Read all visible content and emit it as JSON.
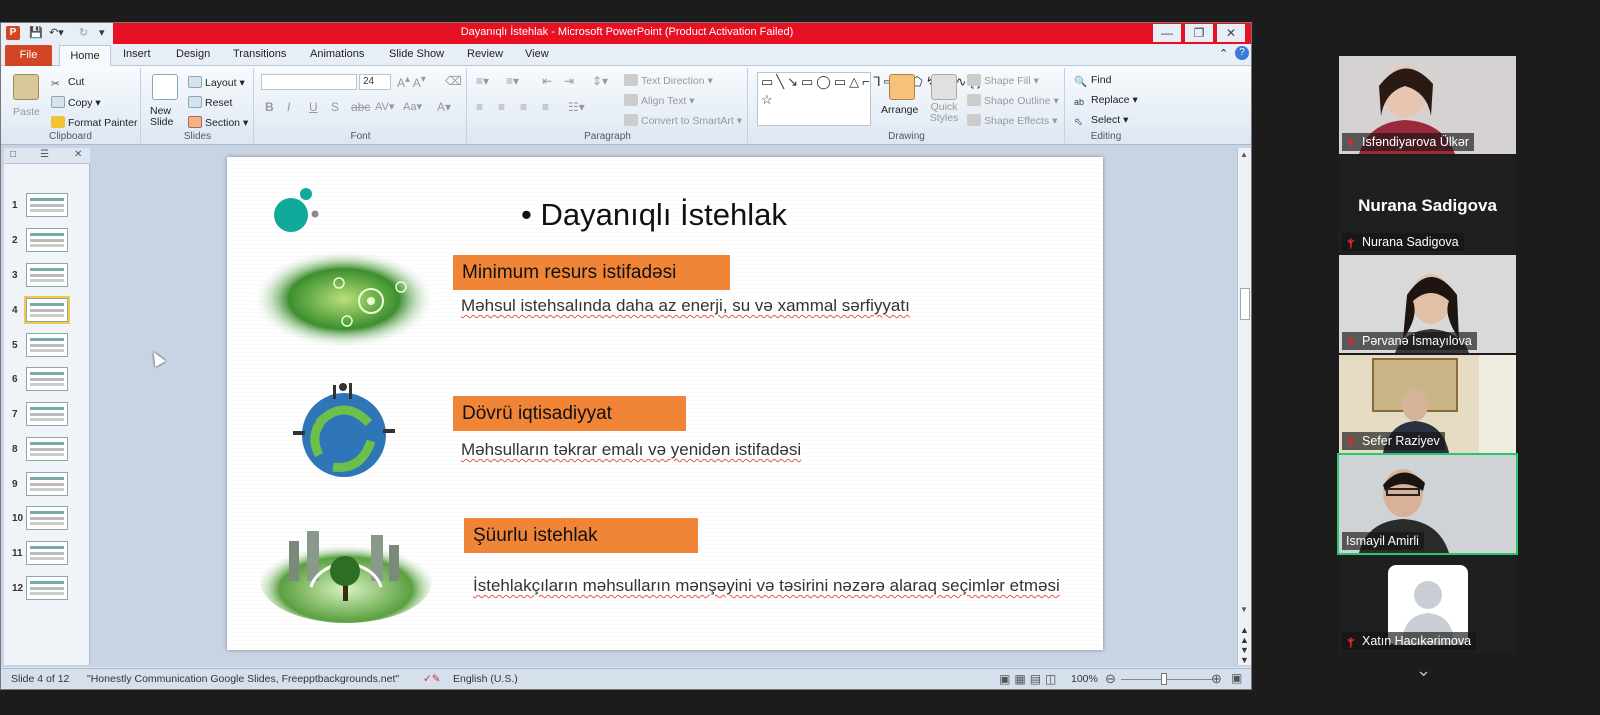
{
  "window": {
    "title": "Dayanıqlı İstehlak  -  Microsoft PowerPoint (Product Activation Failed)"
  },
  "tabs": [
    "File",
    "Home",
    "Insert",
    "Design",
    "Transitions",
    "Animations",
    "Slide Show",
    "Review",
    "View"
  ],
  "ribbon": {
    "clipboard": {
      "label": "Clipboard",
      "paste": "Paste",
      "cut": "Cut",
      "copy": "Copy",
      "format_painter": "Format Painter"
    },
    "slides": {
      "label": "Slides",
      "new_slide": "New Slide",
      "layout": "Layout",
      "reset": "Reset",
      "section": "Section"
    },
    "font": {
      "label": "Font",
      "size": "24"
    },
    "paragraph": {
      "label": "Paragraph",
      "text_direction": "Text Direction",
      "align_text": "Align Text",
      "smartart": "Convert to SmartArt"
    },
    "drawing": {
      "label": "Drawing",
      "arrange": "Arrange",
      "quick_styles": "Quick Styles",
      "shape_fill": "Shape Fill",
      "shape_outline": "Shape Outline",
      "shape_effects": "Shape Effects"
    },
    "editing": {
      "label": "Editing",
      "find": "Find",
      "replace": "Replace",
      "select": "Select"
    }
  },
  "thumbnails": [
    "1",
    "2",
    "3",
    "4",
    "5",
    "6",
    "7",
    "8",
    "9",
    "10",
    "11",
    "12"
  ],
  "selected_slide": 4,
  "slide": {
    "heading": "• Dayanıqlı İstehlak",
    "items": [
      {
        "title": "Minimum resurs istifadəsi",
        "desc": "Məhsul istehsalında daha az enerji, su və xammal sərfiyyatı"
      },
      {
        "title": "Dövrü iqtisadiyyat",
        "desc": "Məhsulların təkrar emalı və yenidən istifadəsi"
      },
      {
        "title": "Şüurlu istehlak",
        "desc": "İstehlakçıların məhsulların mənşəyini və təsirini nəzərə alaraq seçimlər etməsi"
      }
    ]
  },
  "status": {
    "slide_of": "Slide 4 of 12",
    "theme": "\"Honestly Communication Google Slides,  Freepptbackgrounds.net\"",
    "language": "English (U.S.)",
    "zoom": "100%"
  },
  "participants": [
    {
      "name": "Isfəndiyarova Ülkər",
      "video": true
    },
    {
      "name": "Nurana Sadigova",
      "video": false,
      "display": "Nurana Sadigova"
    },
    {
      "name": "Pərvanə İsmayılova",
      "video": true
    },
    {
      "name": "Sefer Raziyev",
      "video": true
    },
    {
      "name": "Ismayil Amirli",
      "video": true,
      "active": true
    },
    {
      "name": "Xatın Hacıkərimova",
      "video": false
    }
  ],
  "colors": {
    "accent_orange": "#f08538",
    "title_red": "#e81123",
    "file_tab": "#d24625",
    "active_speaker": "#28c76f"
  }
}
